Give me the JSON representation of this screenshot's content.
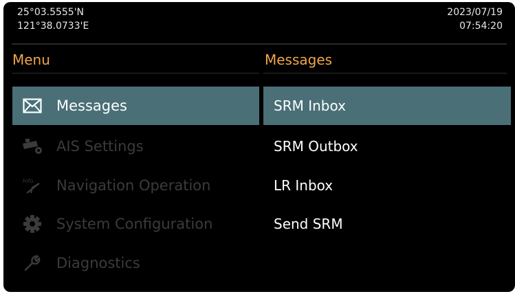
{
  "status": {
    "latitude": "25°03.5555'N",
    "longitude": "121°38.0733'E",
    "date": "2023/07/19",
    "time": "07:54:20"
  },
  "menu": {
    "title": "Menu",
    "items": [
      {
        "label": "Messages",
        "icon": "envelope-icon",
        "state": "selected"
      },
      {
        "label": "AIS Settings",
        "icon": "ship-gear-icon",
        "state": "disabled"
      },
      {
        "label": "Navigation Operation",
        "icon": "info-compass-icon",
        "state": "disabled"
      },
      {
        "label": "System Configuration",
        "icon": "gear-icon",
        "state": "disabled"
      },
      {
        "label": "Diagnostics",
        "icon": "wrench-icon",
        "state": "disabled"
      }
    ]
  },
  "messages": {
    "title": "Messages",
    "items": [
      {
        "label": "SRM Inbox",
        "state": "selected"
      },
      {
        "label": "SRM Outbox"
      },
      {
        "label": "LR Inbox"
      },
      {
        "label": "Send SRM"
      }
    ]
  },
  "colors": {
    "background": "#000000",
    "highlight": "#4a6f77",
    "title_accent": "#f0a648",
    "disabled_text": "#3b3b3b"
  }
}
